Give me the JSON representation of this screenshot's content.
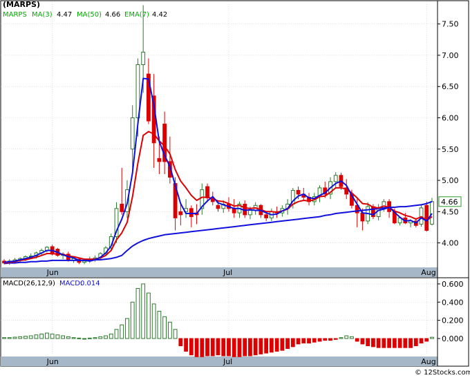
{
  "title": "(MARPS)",
  "legend": {
    "symbol": "MARPS",
    "ma3_label": "MA(3)",
    "ma3_value": "4.47",
    "ma50_label": "MA(50)",
    "ma50_value": "4.66",
    "ema7_label": "EMA(7)",
    "ema7_value": "4.42"
  },
  "last_price_label": "4.66",
  "macd_legend": {
    "params": "MACD(26,12,9)",
    "label": "MACD:",
    "value": "0.014"
  },
  "watermark": "© 12Stocks.com",
  "colors": {
    "up": "#2a7a2a",
    "down": "#dd0000",
    "ma_short": "#dd0000",
    "ma_long": "#1010dd",
    "axis_band": "#a6b8c8",
    "grid": "#cccccc",
    "price_box": "#2a9a2a"
  },
  "chart_data": [
    {
      "type": "candlestick",
      "x_ticks": [
        "Jun",
        "Jul",
        "Aug"
      ],
      "x_tick_index": [
        9,
        42,
        79
      ],
      "y_ticks": [
        "4.00",
        "4.50",
        "5.00",
        "5.50",
        "6.00",
        "6.50",
        "7.00",
        "7.50"
      ],
      "y_tick_values": [
        4.0,
        4.5,
        5.0,
        5.5,
        6.0,
        6.5,
        7.0,
        7.5
      ],
      "ylim": [
        3.62,
        7.85
      ],
      "grid": true,
      "candles": [
        [
          3.71,
          3.74,
          3.66,
          3.68
        ],
        [
          3.68,
          3.74,
          3.65,
          3.71
        ],
        [
          3.71,
          3.76,
          3.67,
          3.73
        ],
        [
          3.73,
          3.77,
          3.69,
          3.75
        ],
        [
          3.75,
          3.8,
          3.71,
          3.78
        ],
        [
          3.78,
          3.83,
          3.74,
          3.79
        ],
        [
          3.79,
          3.86,
          3.75,
          3.84
        ],
        [
          3.84,
          3.91,
          3.8,
          3.88
        ],
        [
          3.88,
          3.95,
          3.85,
          3.93
        ],
        [
          3.94,
          3.97,
          3.8,
          3.82
        ],
        [
          3.9,
          3.92,
          3.78,
          3.8
        ],
        [
          3.8,
          3.85,
          3.74,
          3.82
        ],
        [
          3.82,
          3.86,
          3.7,
          3.72
        ],
        [
          3.72,
          3.78,
          3.68,
          3.75
        ],
        [
          3.74,
          3.76,
          3.66,
          3.69
        ],
        [
          3.69,
          3.74,
          3.66,
          3.71
        ],
        [
          3.71,
          3.78,
          3.68,
          3.73
        ],
        [
          3.73,
          3.8,
          3.7,
          3.76
        ],
        [
          3.76,
          3.85,
          3.72,
          3.83
        ],
        [
          3.83,
          3.95,
          3.8,
          3.92
        ],
        [
          3.92,
          4.15,
          3.88,
          4.1
        ],
        [
          4.1,
          4.65,
          4.0,
          4.55
        ],
        [
          4.62,
          5.2,
          4.45,
          4.5
        ],
        [
          4.5,
          5.0,
          4.4,
          4.85
        ],
        [
          5.5,
          6.2,
          5.1,
          6.0
        ],
        [
          6.0,
          6.95,
          5.7,
          6.85
        ],
        [
          6.85,
          7.8,
          6.4,
          7.05
        ],
        [
          6.7,
          6.95,
          5.9,
          5.95
        ],
        [
          6.35,
          6.7,
          5.2,
          5.6
        ],
        [
          5.35,
          5.7,
          5.1,
          5.3
        ],
        [
          5.9,
          6.1,
          5.1,
          5.3
        ],
        [
          5.3,
          5.7,
          4.95,
          5.05
        ],
        [
          4.95,
          5.05,
          4.2,
          4.4
        ],
        [
          4.5,
          4.65,
          4.28,
          4.45
        ],
        [
          4.5,
          4.7,
          4.4,
          4.55
        ],
        [
          4.55,
          4.6,
          4.25,
          4.42
        ],
        [
          4.48,
          4.62,
          4.3,
          4.45
        ],
        [
          4.55,
          4.95,
          4.45,
          4.85
        ],
        [
          4.9,
          4.95,
          4.65,
          4.72
        ],
        [
          4.7,
          4.82,
          4.6,
          4.66
        ],
        [
          4.6,
          4.68,
          4.5,
          4.55
        ],
        [
          4.55,
          4.68,
          4.48,
          4.62
        ],
        [
          4.62,
          4.73,
          4.5,
          4.55
        ],
        [
          4.55,
          4.7,
          4.4,
          4.48
        ],
        [
          4.48,
          4.66,
          4.4,
          4.62
        ],
        [
          4.62,
          4.68,
          4.4,
          4.45
        ],
        [
          4.45,
          4.58,
          4.38,
          4.52
        ],
        [
          4.52,
          4.65,
          4.45,
          4.6
        ],
        [
          4.6,
          4.62,
          4.4,
          4.45
        ],
        [
          4.45,
          4.5,
          4.35,
          4.4
        ],
        [
          4.4,
          4.55,
          4.35,
          4.5
        ],
        [
          4.5,
          4.58,
          4.4,
          4.48
        ],
        [
          4.48,
          4.6,
          4.42,
          4.55
        ],
        [
          4.55,
          4.7,
          4.45,
          4.62
        ],
        [
          4.62,
          4.88,
          4.55,
          4.84
        ],
        [
          4.84,
          4.9,
          4.7,
          4.78
        ],
        [
          4.78,
          4.88,
          4.68,
          4.73
        ],
        [
          4.73,
          4.8,
          4.6,
          4.66
        ],
        [
          4.66,
          4.8,
          4.6,
          4.74
        ],
        [
          4.74,
          4.92,
          4.65,
          4.88
        ],
        [
          4.88,
          4.98,
          4.72,
          4.78
        ],
        [
          4.78,
          5.05,
          4.7,
          4.98
        ],
        [
          4.98,
          5.13,
          4.88,
          5.08
        ],
        [
          5.08,
          5.12,
          4.85,
          4.9
        ],
        [
          4.88,
          5.02,
          4.7,
          4.78
        ],
        [
          4.78,
          4.85,
          4.55,
          4.6
        ],
        [
          4.6,
          4.7,
          4.25,
          4.48
        ],
        [
          4.48,
          4.55,
          4.2,
          4.35
        ],
        [
          4.35,
          4.65,
          4.3,
          4.58
        ],
        [
          4.58,
          4.62,
          4.38,
          4.42
        ],
        [
          4.42,
          4.62,
          4.36,
          4.55
        ],
        [
          4.55,
          4.7,
          4.5,
          4.66
        ],
        [
          4.66,
          4.7,
          4.4,
          4.5
        ],
        [
          4.5,
          4.55,
          4.3,
          4.32
        ],
        [
          4.32,
          4.42,
          4.28,
          4.4
        ],
        [
          4.4,
          4.48,
          4.3,
          4.32
        ],
        [
          4.32,
          4.38,
          4.25,
          4.35
        ],
        [
          4.35,
          4.4,
          4.25,
          4.28
        ],
        [
          4.3,
          4.6,
          4.26,
          4.56
        ],
        [
          4.6,
          4.66,
          4.18,
          4.2
        ],
        [
          4.3,
          4.72,
          4.28,
          4.66
        ]
      ],
      "ma3": [
        3.69,
        3.7,
        3.71,
        3.73,
        3.75,
        3.77,
        3.8,
        3.84,
        3.88,
        3.88,
        3.85,
        3.81,
        3.78,
        3.76,
        3.72,
        3.72,
        3.71,
        3.73,
        3.77,
        3.84,
        3.95,
        4.19,
        4.38,
        4.63,
        5.12,
        5.9,
        6.63,
        6.62,
        6.2,
        5.62,
        5.4,
        5.22,
        4.92,
        4.63,
        4.47,
        4.47,
        4.47,
        4.58,
        4.67,
        4.74,
        4.64,
        4.61,
        4.58,
        4.55,
        4.55,
        4.52,
        4.53,
        4.52,
        4.52,
        4.48,
        4.45,
        4.46,
        4.51,
        4.55,
        4.67,
        4.75,
        4.78,
        4.72,
        4.71,
        4.76,
        4.8,
        4.88,
        4.95,
        4.99,
        4.92,
        4.76,
        4.62,
        4.48,
        4.47,
        4.45,
        4.52,
        4.54,
        4.57,
        4.49,
        4.41,
        4.35,
        4.36,
        4.32,
        4.4,
        4.35,
        4.47
      ],
      "ema7": [
        3.68,
        3.69,
        3.7,
        3.72,
        3.73,
        3.75,
        3.77,
        3.8,
        3.83,
        3.83,
        3.82,
        3.82,
        3.79,
        3.78,
        3.76,
        3.74,
        3.74,
        3.74,
        3.76,
        3.8,
        3.88,
        4.05,
        4.16,
        4.33,
        4.74,
        5.27,
        5.72,
        5.78,
        5.74,
        5.63,
        5.55,
        5.42,
        5.17,
        4.99,
        4.88,
        4.76,
        4.68,
        4.73,
        4.73,
        4.71,
        4.67,
        4.66,
        4.63,
        4.59,
        4.6,
        4.56,
        4.55,
        4.56,
        4.53,
        4.5,
        4.5,
        4.49,
        4.51,
        4.54,
        4.62,
        4.66,
        4.68,
        4.67,
        4.69,
        4.74,
        4.75,
        4.81,
        4.88,
        4.88,
        4.86,
        4.8,
        4.72,
        4.63,
        4.62,
        4.57,
        4.56,
        4.59,
        4.57,
        4.51,
        4.48,
        4.44,
        4.42,
        4.38,
        4.42,
        4.36,
        4.42
      ],
      "ma50": [
        3.67,
        3.68,
        3.68,
        3.69,
        3.69,
        3.7,
        3.7,
        3.71,
        3.71,
        3.72,
        3.72,
        3.72,
        3.72,
        3.72,
        3.72,
        3.72,
        3.72,
        3.73,
        3.73,
        3.74,
        3.75,
        3.77,
        3.8,
        3.88,
        3.95,
        4.0,
        4.04,
        4.07,
        4.09,
        4.11,
        4.13,
        4.14,
        4.15,
        4.16,
        4.17,
        4.18,
        4.19,
        4.2,
        4.21,
        4.22,
        4.23,
        4.24,
        4.25,
        4.26,
        4.27,
        4.28,
        4.29,
        4.3,
        4.31,
        4.32,
        4.33,
        4.34,
        4.35,
        4.36,
        4.37,
        4.38,
        4.39,
        4.4,
        4.41,
        4.42,
        4.44,
        4.45,
        4.47,
        4.48,
        4.49,
        4.5,
        4.51,
        4.52,
        4.53,
        4.54,
        4.55,
        4.56,
        4.57,
        4.57,
        4.58,
        4.58,
        4.59,
        4.6,
        4.61,
        4.63,
        4.66
      ]
    },
    {
      "type": "bar",
      "name": "MACD(26,12,9)",
      "y_ticks": [
        "0.600",
        "0.400",
        "0.200",
        "0.000"
      ],
      "y_tick_values": [
        0.6,
        0.4,
        0.2,
        0.0
      ],
      "ylim": [
        -0.19,
        0.66
      ],
      "x_ticks": [
        "Jun",
        "Jul",
        "Aug"
      ],
      "values": [
        0.01,
        0.01,
        0.015,
        0.02,
        0.025,
        0.03,
        0.04,
        0.05,
        0.06,
        0.05,
        0.04,
        0.03,
        0.02,
        0.01,
        0.005,
        0.0,
        0.005,
        0.01,
        0.02,
        0.03,
        0.05,
        0.1,
        0.15,
        0.22,
        0.4,
        0.55,
        0.6,
        0.5,
        0.38,
        0.3,
        0.24,
        0.18,
        0.1,
        -0.08,
        -0.14,
        -0.18,
        -0.2,
        -0.2,
        -0.19,
        -0.19,
        -0.18,
        -0.19,
        -0.19,
        -0.2,
        -0.2,
        -0.19,
        -0.19,
        -0.18,
        -0.17,
        -0.16,
        -0.15,
        -0.14,
        -0.13,
        -0.11,
        -0.09,
        -0.06,
        -0.05,
        -0.05,
        -0.04,
        -0.03,
        -0.02,
        -0.02,
        -0.01,
        0.01,
        0.03,
        0.02,
        -0.03,
        -0.06,
        -0.08,
        -0.09,
        -0.1,
        -0.1,
        -0.1,
        -0.1,
        -0.1,
        -0.1,
        -0.1,
        -0.08,
        -0.05,
        -0.03,
        0.014
      ]
    }
  ]
}
